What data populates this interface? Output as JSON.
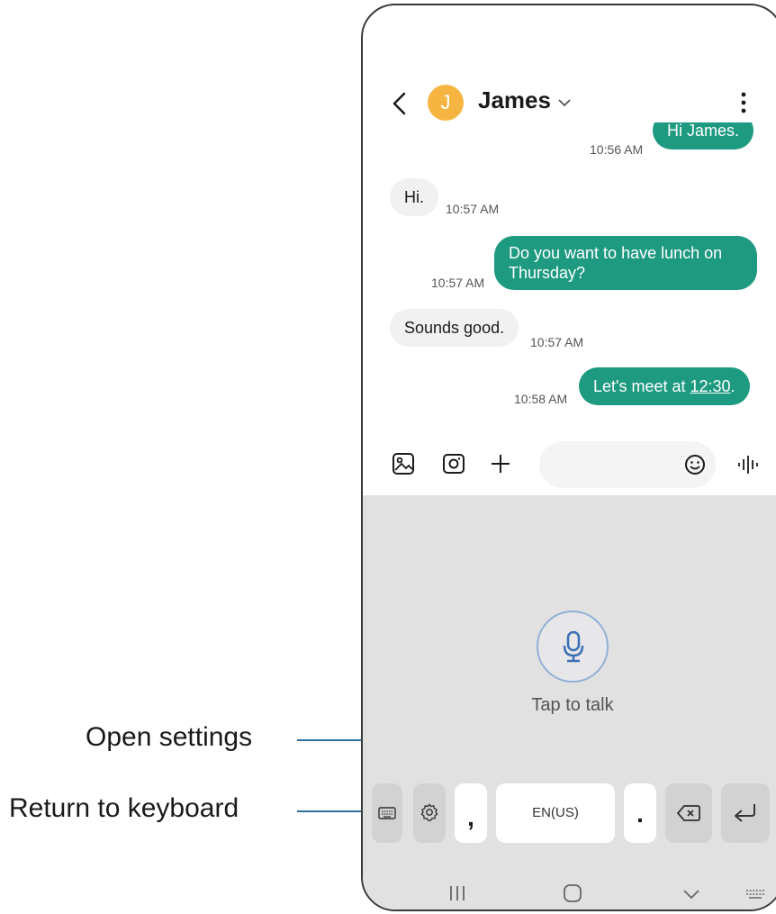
{
  "chat": {
    "contact_name": "James",
    "avatar_initial": "J",
    "messages": [
      {
        "direction": "out",
        "text": "Hi James.",
        "time": "10:56 AM"
      },
      {
        "direction": "in",
        "text": "Hi.",
        "time": "10:57 AM"
      },
      {
        "direction": "out",
        "text_line1": "Do you want to have lunch on",
        "text_line2": "Thursday?",
        "time": "10:57 AM"
      },
      {
        "direction": "in",
        "text": "Sounds good.",
        "time": "10:57 AM"
      },
      {
        "direction": "out",
        "text_prefix": "Let's meet at ",
        "text_link": "12:30",
        "text_suffix": ".",
        "time": "10:58 AM"
      }
    ]
  },
  "composer": {
    "icons": [
      "gallery-icon",
      "camera-icon",
      "plus-icon",
      "emoji-icon",
      "voice-wave-icon"
    ]
  },
  "voice_input": {
    "label": "Tap to talk"
  },
  "keyboard": {
    "comma_key": ",",
    "space_key": "EN(US)",
    "period_key": "."
  },
  "callouts": {
    "open_settings": "Open settings",
    "return_to_keyboard": "Return to keyboard"
  },
  "colors": {
    "outgoing_bubble": "#1e9a80",
    "incoming_bubble": "#f1f1f1",
    "avatar": "#f6b540",
    "callout_line": "#2f6f9f",
    "keyboard_panel": "#e1e1e1"
  }
}
